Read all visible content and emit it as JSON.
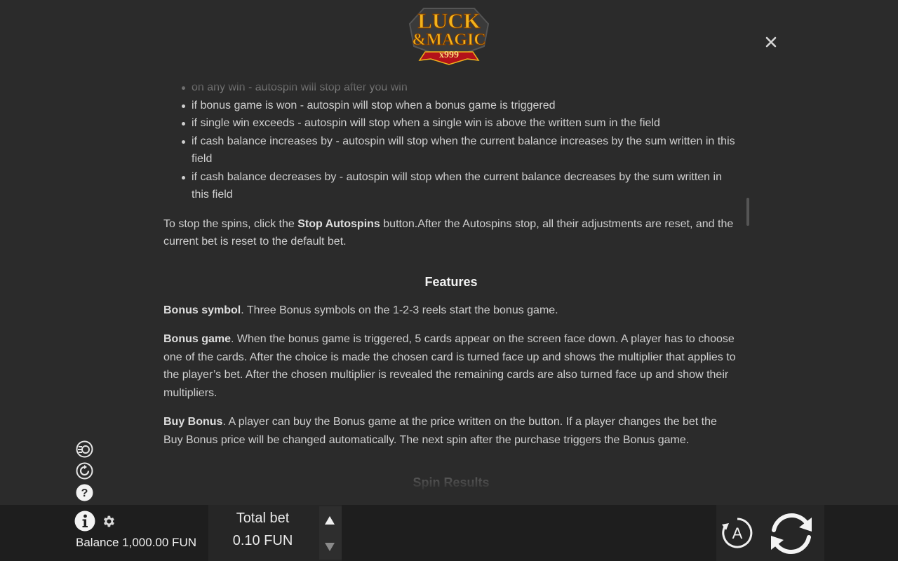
{
  "logo": {
    "line1": "LUCK",
    "line2": "&MAGIC",
    "badge": "x999"
  },
  "content": {
    "bullets": [
      "on any win - autospin will stop after you win",
      "if bonus game is won - autospin will stop when a bonus game is triggered",
      "if single win exceeds - autospin will stop when a single win is above the written sum in the field",
      "if cash balance increases by - autospin will stop when the current balance increases by the sum written in this field",
      "if cash balance decreases by - autospin will stop when the current balance decreases by the sum written in this field"
    ],
    "stop_text_before": "To stop the spins, click the ",
    "stop_bold": "Stop Autospins",
    "stop_text_after": " button.After the Autospins stop, all their adjustments are reset, and the current bet is reset to the default bet.",
    "features_heading": "Features",
    "bonus_symbol_title": "Bonus symbol",
    "bonus_symbol_text": ". Three Bonus symbols on the 1-2-3 reels start the bonus game.",
    "bonus_game_title": "Bonus game",
    "bonus_game_text": ". When the bonus game is triggered, 5 cards appear on the screen face down. A player has to choose one of the cards. After the choice is made the chosen card is turned face up and shows the multiplier that applies to the player’s bet. After the chosen multiplier is revealed the remaining cards are also turned face up and show their multipliers.",
    "buy_bonus_title": "Buy Bonus",
    "buy_bonus_text": ". A player can buy the Bonus game at the price written on the button. If a player changes the bet the Buy Bonus price will be changed automatically. The next spin after the purchase triggers the Bonus game.",
    "spin_results_heading": "Spin Results"
  },
  "bottom": {
    "balance": "Balance 1,000.00 FUN",
    "total_bet_label": "Total bet",
    "total_bet_value": "0.10 FUN"
  },
  "icons": {
    "close": "close-icon",
    "turbo": "turbo-icon",
    "history": "history-icon",
    "help": "help-icon",
    "info": "info-icon",
    "settings": "gear-icon",
    "bet_up": "arrow-up-icon",
    "bet_down": "arrow-down-icon",
    "autoplay": "autoplay-icon",
    "spin": "spin-icon"
  },
  "colors": {
    "background": "#2b2b2b",
    "bar": "#1e1e1e",
    "text": "#cfcfcf",
    "logo_gold": "#f2b31c",
    "logo_red": "#b3121a"
  }
}
